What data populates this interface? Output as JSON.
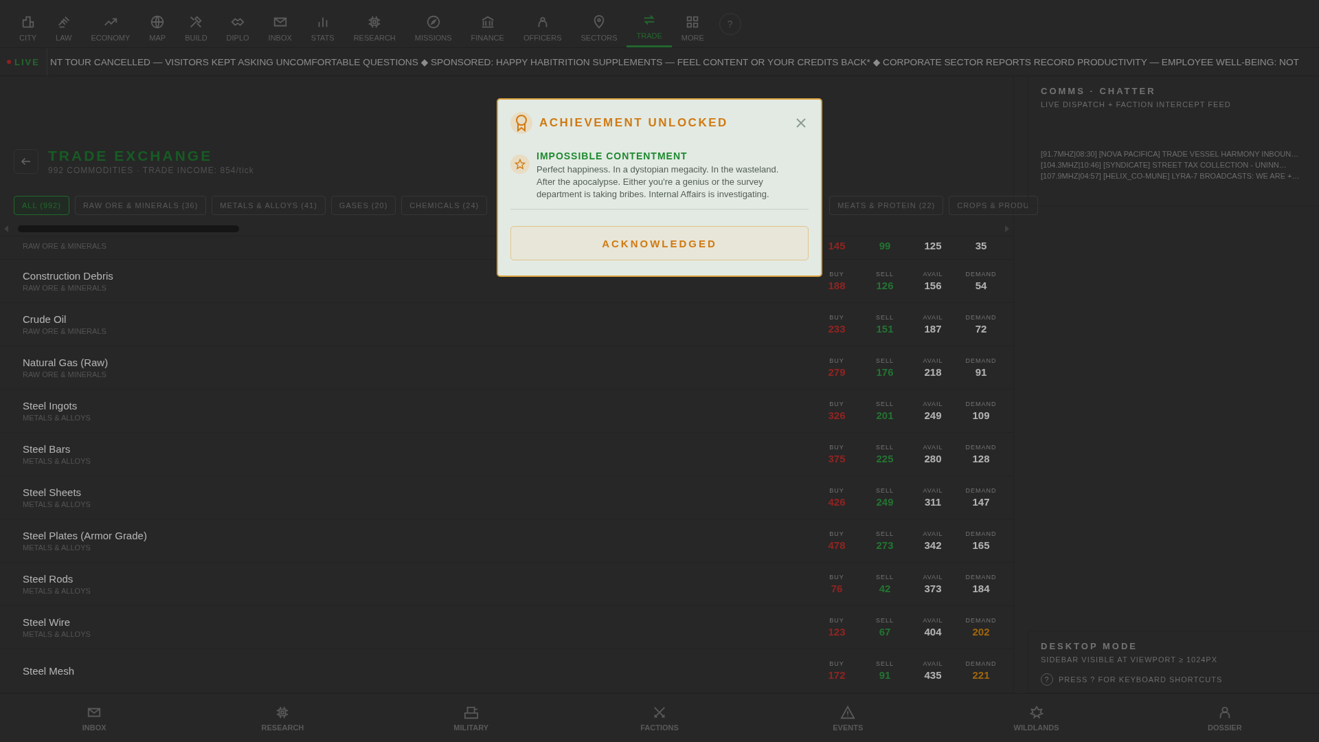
{
  "nav": {
    "items": [
      {
        "label": "CITY",
        "selected": false
      },
      {
        "label": "LAW",
        "selected": false
      },
      {
        "label": "ECONOMY",
        "selected": false
      },
      {
        "label": "MAP",
        "selected": false
      },
      {
        "label": "BUILD",
        "selected": false
      },
      {
        "label": "DIPLO",
        "selected": false
      },
      {
        "label": "INBOX",
        "selected": false
      },
      {
        "label": "STATS",
        "selected": false
      },
      {
        "label": "RESEARCH",
        "selected": false
      },
      {
        "label": "MISSIONS",
        "selected": false
      },
      {
        "label": "FINANCE",
        "selected": false
      },
      {
        "label": "OFFICERS",
        "selected": false
      },
      {
        "label": "SECTORS",
        "selected": false
      },
      {
        "label": "TRADE",
        "selected": true
      },
      {
        "label": "MORE",
        "selected": false
      }
    ],
    "help": "?"
  },
  "ticker": {
    "badge": "LIVE",
    "text": "NT TOUR CANCELLED — VISITORS KEPT ASKING UNCOMFORTABLE QUESTIONS ◆ SPONSORED: HAPPY HABITRITION SUPPLEMENTS — FEEL CONTENT OR YOUR CREDITS BACK* ◆ CORPORATE SECTOR REPORTS RECORD PRODUCTIVITY — EMPLOYEE WELL-BEING: NOT"
  },
  "header": {
    "title": "TRADE EXCHANGE",
    "subtitle": "992 COMMODITIES · TRADE INCOME: 854/tick"
  },
  "filters": [
    {
      "label": "ALL (992)",
      "selected": true
    },
    {
      "label": "RAW ORE & MINERALS (36)",
      "selected": false
    },
    {
      "label": "METALS & ALLOYS (41)",
      "selected": false
    },
    {
      "label": "GASES (20)",
      "selected": false
    },
    {
      "label": "CHEMICALS (24)",
      "selected": false
    },
    {
      "label": "MEATS & PROTEIN (22)",
      "selected": false
    },
    {
      "label": "CROPS & PRODU",
      "selected": false
    }
  ],
  "commodities": [
    {
      "kind": "partial",
      "category": "RAW ORE & MINERALS",
      "stats": [
        {
          "kind": "buy",
          "value": "145"
        },
        {
          "kind": "sell",
          "value": "99"
        },
        {
          "kind": "avail",
          "value": "125"
        },
        {
          "kind": "demand",
          "value": "35",
          "high": false
        }
      ]
    },
    {
      "kind": "full",
      "name": "Construction Debris",
      "category": "RAW ORE & MINERALS",
      "stats": [
        {
          "kind": "buy",
          "label": "BUY",
          "value": "188"
        },
        {
          "kind": "sell",
          "label": "SELL",
          "value": "126"
        },
        {
          "kind": "avail",
          "label": "AVAIL",
          "value": "156"
        },
        {
          "kind": "demand",
          "label": "DEMAND",
          "value": "54",
          "high": false
        }
      ]
    },
    {
      "kind": "full",
      "name": "Crude Oil",
      "category": "RAW ORE & MINERALS",
      "stats": [
        {
          "kind": "buy",
          "label": "BUY",
          "value": "233"
        },
        {
          "kind": "sell",
          "label": "SELL",
          "value": "151"
        },
        {
          "kind": "avail",
          "label": "AVAIL",
          "value": "187"
        },
        {
          "kind": "demand",
          "label": "DEMAND",
          "value": "72",
          "high": false
        }
      ]
    },
    {
      "kind": "full",
      "name": "Natural Gas (Raw)",
      "category": "RAW ORE & MINERALS",
      "stats": [
        {
          "kind": "buy",
          "label": "BUY",
          "value": "279"
        },
        {
          "kind": "sell",
          "label": "SELL",
          "value": "176"
        },
        {
          "kind": "avail",
          "label": "AVAIL",
          "value": "218"
        },
        {
          "kind": "demand",
          "label": "DEMAND",
          "value": "91",
          "high": false
        }
      ]
    },
    {
      "kind": "full",
      "name": "Steel Ingots",
      "category": "METALS & ALLOYS",
      "stats": [
        {
          "kind": "buy",
          "label": "BUY",
          "value": "326"
        },
        {
          "kind": "sell",
          "label": "SELL",
          "value": "201"
        },
        {
          "kind": "avail",
          "label": "AVAIL",
          "value": "249"
        },
        {
          "kind": "demand",
          "label": "DEMAND",
          "value": "109",
          "high": false
        }
      ]
    },
    {
      "kind": "full",
      "name": "Steel Bars",
      "category": "METALS & ALLOYS",
      "stats": [
        {
          "kind": "buy",
          "label": "BUY",
          "value": "375"
        },
        {
          "kind": "sell",
          "label": "SELL",
          "value": "225"
        },
        {
          "kind": "avail",
          "label": "AVAIL",
          "value": "280"
        },
        {
          "kind": "demand",
          "label": "DEMAND",
          "value": "128",
          "high": false
        }
      ]
    },
    {
      "kind": "full",
      "name": "Steel Sheets",
      "category": "METALS & ALLOYS",
      "stats": [
        {
          "kind": "buy",
          "label": "BUY",
          "value": "426"
        },
        {
          "kind": "sell",
          "label": "SELL",
          "value": "249"
        },
        {
          "kind": "avail",
          "label": "AVAIL",
          "value": "311"
        },
        {
          "kind": "demand",
          "label": "DEMAND",
          "value": "147",
          "high": false
        }
      ]
    },
    {
      "kind": "full",
      "name": "Steel Plates (Armor Grade)",
      "category": "METALS & ALLOYS",
      "stats": [
        {
          "kind": "buy",
          "label": "BUY",
          "value": "478"
        },
        {
          "kind": "sell",
          "label": "SELL",
          "value": "273"
        },
        {
          "kind": "avail",
          "label": "AVAIL",
          "value": "342"
        },
        {
          "kind": "demand",
          "label": "DEMAND",
          "value": "165",
          "high": false
        }
      ]
    },
    {
      "kind": "full",
      "name": "Steel Rods",
      "category": "METALS & ALLOYS",
      "stats": [
        {
          "kind": "buy",
          "label": "BUY",
          "value": "76"
        },
        {
          "kind": "sell",
          "label": "SELL",
          "value": "42"
        },
        {
          "kind": "avail",
          "label": "AVAIL",
          "value": "373"
        },
        {
          "kind": "demand",
          "label": "DEMAND",
          "value": "184",
          "high": false
        }
      ]
    },
    {
      "kind": "full",
      "name": "Steel Wire",
      "category": "METALS & ALLOYS",
      "stats": [
        {
          "kind": "buy",
          "label": "BUY",
          "value": "123"
        },
        {
          "kind": "sell",
          "label": "SELL",
          "value": "67"
        },
        {
          "kind": "avail",
          "label": "AVAIL",
          "value": "404"
        },
        {
          "kind": "demand",
          "label": "DEMAND",
          "value": "202",
          "high": true
        }
      ]
    },
    {
      "kind": "full",
      "name": "Steel Mesh",
      "stats": [
        {
          "kind": "buy",
          "label": "BUY",
          "value": "172"
        },
        {
          "kind": "sell",
          "label": "SELL",
          "value": "91"
        },
        {
          "kind": "avail",
          "label": "AVAIL",
          "value": "435"
        },
        {
          "kind": "demand",
          "label": "DEMAND",
          "value": "221",
          "high": true
        }
      ]
    }
  ],
  "sidebar": {
    "chatter": {
      "title": "COMMS · CHATTER",
      "subtitle": "LIVE DISPATCH + FACTION INTERCEPT FEED",
      "lines": [
        "[91.7MHZ|08:30] [NOVA PACIFICA] TRADE VESSEL HARMONY INBOUN…",
        "[104.3MHZ|10:46] [SYNDICATE] STREET TAX COLLECTION - UNINN…",
        "[107.9MHZ|04:57] [HELIX_CO-MUNE] LYRA-7 BROADCASTS: WE ARE +…"
      ]
    },
    "desktop": {
      "title": "DESKTOP MODE",
      "text": "SIDEBAR VISIBLE AT VIEWPORT ≥ 1024PX",
      "key": "?",
      "hint": "PRESS ? FOR KEYBOARD SHORTCUTS"
    }
  },
  "bottom_nav": [
    "INBOX",
    "RESEARCH",
    "MILITARY",
    "FACTIONS",
    "EVENTS",
    "WILDLANDS",
    "DOSSIER"
  ],
  "modal": {
    "title": "ACHIEVEMENT UNLOCKED",
    "name": "IMPOSSIBLE CONTENTMENT",
    "description": "Perfect happiness. In a dystopian megacity. In the wasteland. After the apocalypse. Either you're a genius or the survey department is taking bribes. Internal Affairs is investigating.",
    "button": "ACKNOWLEDGED"
  }
}
